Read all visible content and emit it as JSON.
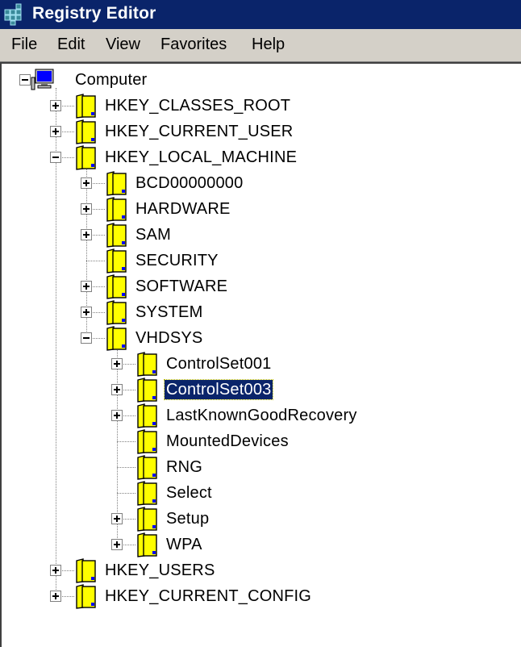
{
  "window": {
    "title": "Registry Editor"
  },
  "menu": [
    "File",
    "Edit",
    "View",
    "Favorites",
    "Help"
  ],
  "colors": {
    "titlebar": "#0a246a",
    "selection": "#0a246a",
    "folder": "#ffff00"
  },
  "tree": [
    {
      "label": "Computer",
      "level": 0,
      "expander": "minus",
      "icon": "computer-icon"
    },
    {
      "label": "HKEY_CLASSES_ROOT",
      "level": 1,
      "expander": "plus",
      "icon": "folder-icon"
    },
    {
      "label": "HKEY_CURRENT_USER",
      "level": 1,
      "expander": "plus",
      "icon": "folder-icon"
    },
    {
      "label": "HKEY_LOCAL_MACHINE",
      "level": 1,
      "expander": "minus",
      "icon": "folder-icon"
    },
    {
      "label": "BCD00000000",
      "level": 2,
      "expander": "plus",
      "icon": "folder-icon"
    },
    {
      "label": "HARDWARE",
      "level": 2,
      "expander": "plus",
      "icon": "folder-icon"
    },
    {
      "label": "SAM",
      "level": 2,
      "expander": "plus",
      "icon": "folder-icon"
    },
    {
      "label": "SECURITY",
      "level": 2,
      "expander": "none",
      "icon": "folder-icon"
    },
    {
      "label": "SOFTWARE",
      "level": 2,
      "expander": "plus",
      "icon": "folder-icon"
    },
    {
      "label": "SYSTEM",
      "level": 2,
      "expander": "plus",
      "icon": "folder-icon"
    },
    {
      "label": "VHDSYS",
      "level": 2,
      "expander": "minus",
      "icon": "folder-icon"
    },
    {
      "label": "ControlSet001",
      "level": 3,
      "expander": "plus",
      "icon": "folder-icon"
    },
    {
      "label": "ControlSet003",
      "level": 3,
      "expander": "plus",
      "icon": "folder-icon",
      "selected": true
    },
    {
      "label": "LastKnownGoodRecovery",
      "level": 3,
      "expander": "plus",
      "icon": "folder-icon"
    },
    {
      "label": "MountedDevices",
      "level": 3,
      "expander": "none",
      "icon": "folder-icon"
    },
    {
      "label": "RNG",
      "level": 3,
      "expander": "none",
      "icon": "folder-icon"
    },
    {
      "label": "Select",
      "level": 3,
      "expander": "none",
      "icon": "folder-icon"
    },
    {
      "label": "Setup",
      "level": 3,
      "expander": "plus",
      "icon": "folder-icon"
    },
    {
      "label": "WPA",
      "level": 3,
      "expander": "plus",
      "icon": "folder-icon"
    },
    {
      "label": "HKEY_USERS",
      "level": 1,
      "expander": "plus",
      "icon": "folder-icon"
    },
    {
      "label": "HKEY_CURRENT_CONFIG",
      "level": 1,
      "expander": "plus",
      "icon": "folder-icon"
    }
  ]
}
